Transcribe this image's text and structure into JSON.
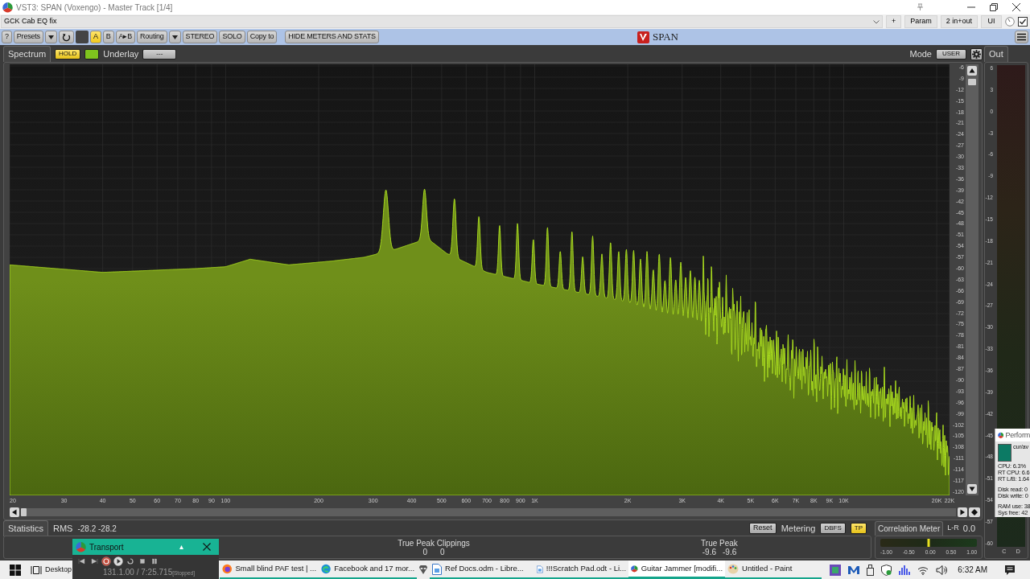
{
  "window": {
    "title": "VST3: SPAN (Voxengo) - Master Track [1/4]"
  },
  "preset_bar": {
    "preset": "GCK Cab EQ fix",
    "buttons": [
      "+",
      "Param",
      "2 in+out",
      "UI"
    ],
    "enabled_checked": true
  },
  "toolbar": {
    "items": [
      {
        "kind": "button",
        "label": "?"
      },
      {
        "kind": "button",
        "label": "Presets"
      },
      {
        "kind": "caret"
      },
      {
        "kind": "undo"
      },
      {
        "kind": "swatch"
      },
      {
        "kind": "slot",
        "label": "A",
        "selected": true
      },
      {
        "kind": "slot",
        "label": "B",
        "selected": false
      },
      {
        "kind": "button",
        "label": "A▸B"
      },
      {
        "kind": "button",
        "label": "Routing"
      },
      {
        "kind": "caret"
      },
      {
        "kind": "button",
        "label": "STEREO"
      },
      {
        "kind": "button",
        "label": "SOLO"
      },
      {
        "kind": "button",
        "label": "Copy to"
      },
      {
        "kind": "wide",
        "label": "HIDE METERS AND STATS"
      }
    ],
    "logo": "SPAN"
  },
  "spectrum": {
    "tab": "Spectrum",
    "hold": {
      "label": "HOLD",
      "on": true
    },
    "freeze_on": true,
    "underlay_label": "Underlay",
    "underlay_value": "---",
    "mode_label": "Mode",
    "mode_value": "USER",
    "y_labels": [
      "-6",
      "-9",
      "-12",
      "-15",
      "-18",
      "-21",
      "-24",
      "-27",
      "-30",
      "-33",
      "-36",
      "-39",
      "-42",
      "-45",
      "-48",
      "-51",
      "-54",
      "-57",
      "-60",
      "-63",
      "-66",
      "-69",
      "-72",
      "-75",
      "-78",
      "-81",
      "-84",
      "-87",
      "-90",
      "-93",
      "-96",
      "-99",
      "-102",
      "-105",
      "-108",
      "-111",
      "-114",
      "-117",
      "-120"
    ],
    "x_labels": [
      "20",
      "30",
      "40",
      "50",
      "60",
      "70",
      "80",
      "90",
      "100",
      "200",
      "300",
      "400",
      "500",
      "600",
      "700",
      "800",
      "900",
      "1K",
      "2K",
      "3K",
      "4K",
      "5K",
      "6K",
      "7K",
      "8K",
      "9K",
      "10K",
      "20K",
      "22K"
    ]
  },
  "out_meter": {
    "tab": "Out",
    "scale": [
      "6",
      "3",
      "0",
      "-3",
      "-6",
      "-9",
      "-12",
      "-15",
      "-18",
      "-21",
      "-24",
      "-27",
      "-30",
      "-33",
      "-36",
      "-39",
      "-42",
      "-45",
      "-48",
      "-51",
      "-54",
      "-57",
      "-60"
    ],
    "channels": [
      "C",
      "D"
    ]
  },
  "statistics": {
    "tab": "Statistics",
    "rms_label": "RMS",
    "rms_values": "-28.2 -28.2",
    "reset": "Reset",
    "metering_label": "Metering",
    "metering_value": "DBFS",
    "tp": {
      "label": "TP",
      "on": true
    },
    "clippings_label": "True Peak Clippings",
    "clippings": [
      "0",
      "0"
    ],
    "true_peak_label": "True Peak",
    "true_peak": [
      "-9.6",
      "-9.6"
    ]
  },
  "correlation": {
    "tab": "Correlation Meter",
    "mode": "L-R",
    "value": "0.0",
    "level": 0.5,
    "scale": [
      "-1.00",
      "-0.50",
      "0.00",
      "0.50",
      "1.00"
    ]
  },
  "transport": {
    "title": "Transport",
    "position": "131.1.00 / 7:25.715",
    "status": "[Stopped]"
  },
  "performance": {
    "title": "Perform",
    "graph_label": "cur/av",
    "groups": [
      [
        "CPU: 6.3%",
        "RT CPU: 6.6",
        "RT L/B: 1.64"
      ],
      [
        "Disk read: 0",
        "Disk write: 0"
      ],
      [
        "RAM use: 38",
        "Sys free: 42"
      ]
    ]
  },
  "taskbar": {
    "desktop": "Desktop",
    "apps": [
      {
        "kind": "browser",
        "label": "Small blind PAF test | ...",
        "selected": false
      },
      {
        "kind": "edge",
        "label": "Facebook and 17 mor...",
        "selected": false
      },
      {
        "kind": "pinned",
        "selected": false
      },
      {
        "kind": "doc",
        "label": "Ref Docs.odm - Libre...",
        "selected": false
      },
      {
        "kind": "doc",
        "label": "!!!Scratch Pad.odt - Li...",
        "selected": false
      },
      {
        "kind": "daw",
        "label": "Guitar Jammer [modifi...",
        "selected": true
      },
      {
        "kind": "paint",
        "label": "Untitled - Paint",
        "selected": false
      }
    ],
    "time": "6:32 AM"
  }
}
